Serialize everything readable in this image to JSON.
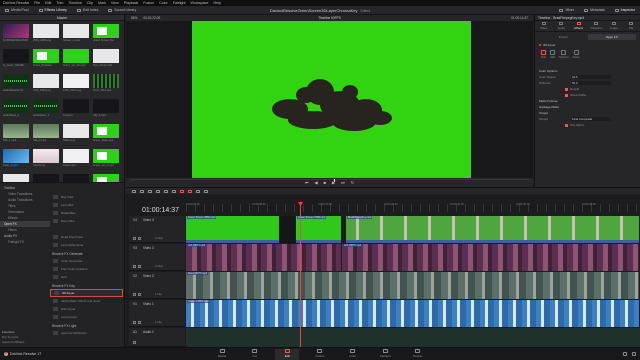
{
  "menu": [
    "DaVinci Resolve",
    "File",
    "Edit",
    "Trim",
    "Timeline",
    "Clip",
    "Mark",
    "View",
    "Playback",
    "Fusion",
    "Color",
    "Fairlight",
    "Workspace",
    "Help"
  ],
  "toolbar": {
    "left": [
      "Media Pool",
      "Effects Library",
      "Edit Index",
      "Sound Library"
    ],
    "project_title": "DavinciResolveGreenScreen3DLayerChromaKey",
    "edited": "Edited",
    "right": [
      "Mixer",
      "Metadata",
      "Inspector"
    ]
  },
  "media_pool": {
    "bin": "Master",
    "clips": [
      {
        "name": "S1:BNZEZ45A1S5DP",
        "thumb": "t-purple"
      },
      {
        "name": "2501_1086.png",
        "thumb": "t-white"
      },
      {
        "name": "Screen_1.mp4",
        "thumb": "t-white"
      },
      {
        "name": "Green Screen Pa...",
        "thumb": "t-green"
      },
      {
        "name": "G_Green_N9s1Bt...",
        "thumb": "t-dark"
      },
      {
        "name": "Green_Particles...",
        "thumb": "t-green"
      },
      {
        "name": "Green_scr_S4.mp4",
        "thumb": "t-green"
      },
      {
        "name": "Pipe_Drops.mp4",
        "thumb": "t-white"
      },
      {
        "name": "AudioWaveform1",
        "thumb": "t-wave"
      },
      {
        "name": "CUP_1003.png",
        "thumb": "t-white"
      },
      {
        "name": "1200_1010.png",
        "thumb": "t-doc"
      },
      {
        "name": "Zoom_Blur.mp4",
        "thumb": "t-stripes"
      },
      {
        "name": "AudioWave_2",
        "thumb": "t-wave"
      },
      {
        "name": "AudioWave_3",
        "thumb": "t-wave"
      },
      {
        "name": "Screen1",
        "thumb": "t-dark"
      },
      {
        "name": "Clip_2.mp4",
        "thumb": "t-dark"
      },
      {
        "name": "Talk_1.mp4",
        "thumb": "t-people"
      },
      {
        "name": "Talk_2.mp4",
        "thumb": "t-people"
      },
      {
        "name": "Slides.png",
        "thumb": "t-white"
      },
      {
        "name": "Green_Slide.mp4",
        "thumb": "t-green"
      },
      {
        "name": "Desk_1.mp4",
        "thumb": "t-blue"
      },
      {
        "name": "Cloud.png",
        "thumb": "t-pink"
      },
      {
        "name": "Paper.mp4",
        "thumb": "t-doc"
      },
      {
        "name": "Green_scr_2.mp4",
        "thumb": "t-green"
      },
      {
        "name": "Alphabet.png",
        "thumb": "t-white"
      },
      {
        "name": "Black_01.mp4",
        "thumb": "t-dark"
      },
      {
        "name": "Black_02.mp4",
        "thumb": "t-dark"
      },
      {
        "name": "Green_03.mp4",
        "thumb": "t-green"
      }
    ]
  },
  "effects": {
    "tree": [
      {
        "label": "Toolbox",
        "cat": true
      },
      {
        "label": "Video Transitions",
        "cat": false
      },
      {
        "label": "Audio Transitions",
        "cat": false
      },
      {
        "label": "Titles",
        "cat": false
      },
      {
        "label": "Generators",
        "cat": false
      },
      {
        "label": "Effects",
        "cat": false
      },
      {
        "label": "Open FX",
        "cat": true,
        "sel": true
      },
      {
        "label": "Filters",
        "cat": false
      },
      {
        "label": "Audio FX",
        "cat": true
      },
      {
        "label": "Fairlight FX",
        "cat": false
      }
    ],
    "groups": [
      {
        "title": "",
        "items": [
          "Ray Cast",
          "Lens Blur",
          "Radial Blur",
          "Zoom Blur"
        ]
      },
      {
        "title": "",
        "items": [
          "Dead Pixel Fixer",
          "Lens Reflections"
        ]
      },
      {
        "title": "Resolve FX Generate",
        "items": [
          "Color Generator",
          "Four Color Gradient",
          "Grid"
        ]
      },
      {
        "title": "Resolve FX Key",
        "items": [
          "3D Keyer",
          "Alpha Matte Shrink and Grow",
          "HSL Keyer",
          "Luma Keyer"
        ]
      },
      {
        "title": "Resolve FX Light",
        "items": [
          "Aperture Diffraction"
        ]
      }
    ],
    "selected": "3D Keyer",
    "favorites_title": "Favorites",
    "favorites": [
      "Dip To Color",
      "Aperture Diffract..."
    ]
  },
  "viewer": {
    "zoom": "58%",
    "source_tc": "00:01:22:08",
    "timeline_name": "Timeline 60FPS",
    "record_tc": "01:00:14:37"
  },
  "inspector": {
    "title": "Timeline - BradFfmpegKey.mp4",
    "tabs": [
      "Video",
      "Audio",
      "Effects",
      "Transition",
      "Image",
      "File"
    ],
    "active_tab": "Effects",
    "sub_tabs": [
      "Fusion",
      "Open FX"
    ],
    "active_sub_tab": "Open FX",
    "effect_name": "3D Keyer",
    "picker_labels": [
      "Pick",
      "Add",
      "Subtract",
      "Reset"
    ],
    "sections": [
      {
        "label": "Color Options",
        "head": true
      },
      {
        "label": "Color Space",
        "value": "HLS",
        "head": false
      },
      {
        "label": "Softness",
        "value": "50.0",
        "head": false
      },
      {
        "label": "Despill",
        "check": true
      },
      {
        "label": "Show Paths",
        "check": true
      },
      {
        "label": "Matte Finesse",
        "head": true
      },
      {
        "label": "Garbage Matte",
        "head": true
      },
      {
        "label": "Output",
        "head": true
      },
      {
        "label": "Output",
        "value": "Final Composite",
        "head": false
      },
      {
        "label": "Use Alpha",
        "check": true
      }
    ]
  },
  "timeline": {
    "timecode": "01:00:14:37",
    "ruler_marks": [
      "01:00:00:00",
      "01:00:08:00",
      "01:00:16:00",
      "01:00:24:00",
      "01:00:32:00",
      "01:00:40:00",
      "01:00:48:00"
    ],
    "tracks": [
      {
        "id": "V4",
        "name": "Video 4",
        "clips": "3 Clips",
        "kind": "video"
      },
      {
        "id": "V3",
        "name": "Video 3",
        "clips": "3 Clips",
        "kind": "video"
      },
      {
        "id": "V2",
        "name": "Video 2",
        "clips": "1 Clip",
        "kind": "video"
      },
      {
        "id": "V1",
        "name": "Video 1",
        "clips": "1 Clip",
        "kind": "video"
      },
      {
        "id": "A1",
        "name": "Audio 1",
        "clips": "",
        "kind": "audio"
      }
    ],
    "clip_labels": {
      "v4a": "Green Screen  2560.mp4",
      "v4b": "Green Screen  7508.mp4",
      "v4c": "BradFfmpegKey.mp4",
      "v3a": "Jeff  10674.mp4",
      "v3b": "Jeff  10675.mp4",
      "v2": "River  10679.mp4",
      "v1": "Ocean  10981.mp4"
    }
  },
  "pages": [
    "Media",
    "Cut",
    "Edit",
    "Fusion",
    "Color",
    "Fairlight",
    "Deliver"
  ],
  "active_page": "Edit",
  "app_name": "DaVinci Resolve 17",
  "colors": {
    "accent": "#e45f4e",
    "key_green": "#32d411",
    "playhead": "#e14b42"
  }
}
